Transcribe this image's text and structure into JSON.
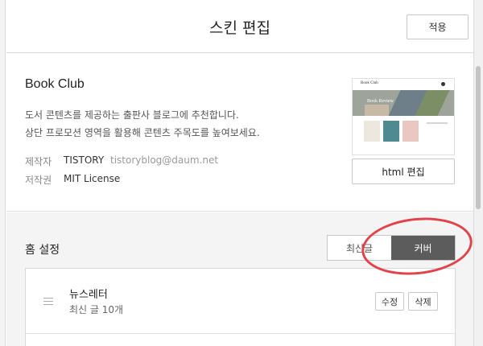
{
  "header": {
    "title": "스킨 편집",
    "apply_label": "적용"
  },
  "skin": {
    "name": "Book Club",
    "description": [
      "도서 콘텐츠를 제공하는 출판사 블로그에 추천합니다.",
      "상단 프로모션 영역을 활용해 콘텐츠 주목도를 높여보세요."
    ],
    "maker_label": "제작자",
    "maker_name": "TISTORY",
    "maker_email": "tistoryblog@daum.net",
    "license_label": "저작권",
    "license_value": "MIT License",
    "preview": {
      "brand": "Book Club",
      "banner_text": "Book Review"
    },
    "html_edit_label": "html 편집"
  },
  "home_settings": {
    "title": "홈 설정",
    "toggle": [
      {
        "label": "최신글",
        "active": false
      },
      {
        "label": "커버",
        "active": true
      }
    ],
    "items": [
      {
        "title": "뉴스레터",
        "subtitle": "최신 글 10개",
        "edit_label": "수정",
        "delete_label": "삭제"
      }
    ]
  },
  "annotation": {
    "color": "#e2434a"
  }
}
